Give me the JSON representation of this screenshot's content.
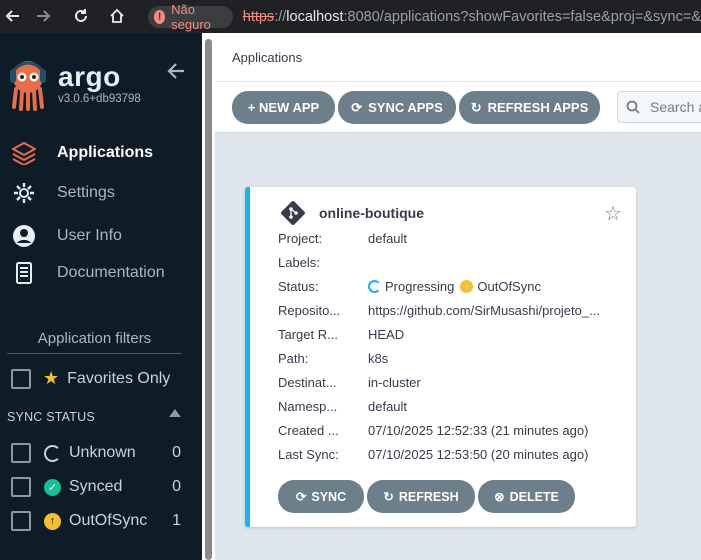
{
  "browser": {
    "back_icon": "arrow-left-icon",
    "forward_icon": "arrow-right-icon",
    "reload_icon": "reload-icon",
    "home_icon": "home-icon",
    "security_label": "Não seguro",
    "url_scheme": "https",
    "url_host": "localhost",
    "url_rest": ":8080/applications?showFavorites=false&proj=&sync=&"
  },
  "sidebar": {
    "brand": "argo",
    "version": "v3.0.6+db93798",
    "nav": [
      {
        "label": "Applications",
        "icon": "layers-icon",
        "active": true
      },
      {
        "label": "Settings",
        "icon": "gear-icon",
        "active": false
      },
      {
        "label": "User Info",
        "icon": "user-circle-icon",
        "active": false
      },
      {
        "label": "Documentation",
        "icon": "document-icon",
        "active": false
      }
    ],
    "filters_title": "Application filters",
    "favorites_label": "Favorites Only",
    "sync_status_title": "SYNC STATUS",
    "sync_status": [
      {
        "label": "Unknown",
        "count": "0",
        "icon": "circle-notch-icon",
        "color": "#c9d3d9"
      },
      {
        "label": "Synced",
        "count": "0",
        "icon": "check-circle-icon",
        "color": "#18be94"
      },
      {
        "label": "OutOfSync",
        "count": "1",
        "icon": "arrow-up-circle-icon",
        "color": "#f4c030"
      }
    ]
  },
  "main": {
    "page_title": "Applications",
    "toolbar": {
      "new_app": "+ NEW APP",
      "sync_apps": "SYNC APPS",
      "refresh_apps": "REFRESH APPS"
    },
    "search_placeholder": "Search a"
  },
  "app_card": {
    "name": "online-boutique",
    "fields": [
      {
        "key": "Project:",
        "value": "default"
      },
      {
        "key": "Labels:",
        "value": ""
      },
      {
        "key": "Status:",
        "value": ""
      },
      {
        "key": "Reposito...",
        "value": "https://github.com/SirMusashi/projeto_..."
      },
      {
        "key": "Target R...",
        "value": "HEAD"
      },
      {
        "key": "Path:",
        "value": "k8s"
      },
      {
        "key": "Destinat...",
        "value": "in-cluster"
      },
      {
        "key": "Namesp...",
        "value": "default"
      },
      {
        "key": "Created ...",
        "value": "07/10/2025 12:52:33  (21 minutes ago)"
      },
      {
        "key": "Last Sync:",
        "value": "07/10/2025 12:53:50  (20 minutes ago)"
      }
    ],
    "health_status": "Progressing",
    "sync_status": "OutOfSync",
    "buttons": {
      "sync": "SYNC",
      "refresh": "REFRESH",
      "delete": "DELETE"
    }
  },
  "colors": {
    "accent": "#18b6e8",
    "button": "#6d7f8b",
    "sidebar_bg": "#0d1c26",
    "warning": "#f4c030"
  }
}
